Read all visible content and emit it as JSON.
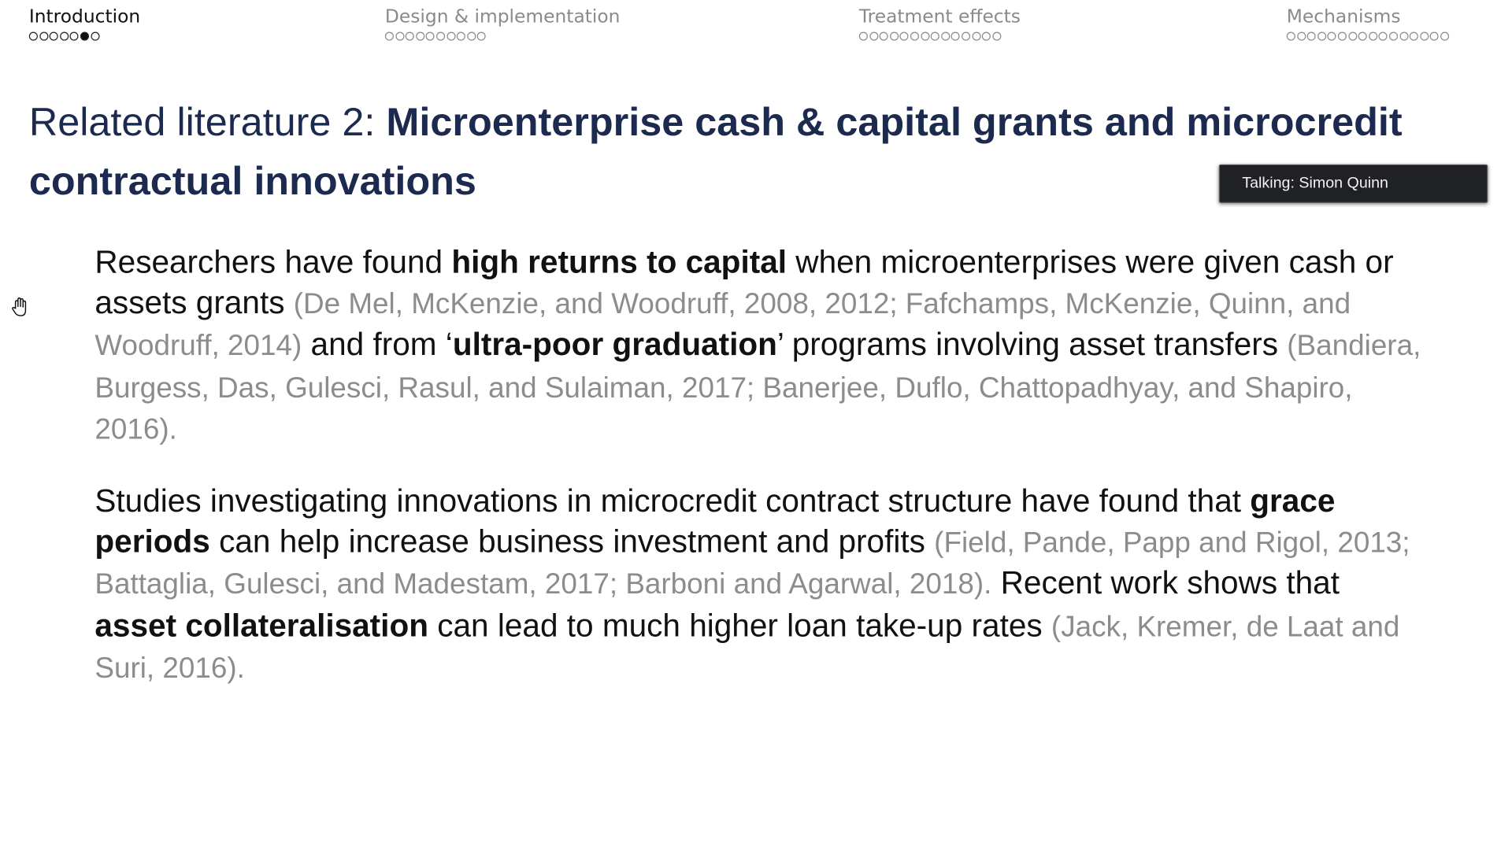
{
  "nav": {
    "sections": [
      {
        "title": "Introduction",
        "dot_count": 7,
        "filled_index": 5,
        "current": true
      },
      {
        "title": "Design & implementation",
        "dot_count": 10,
        "filled_index": -1,
        "current": false
      },
      {
        "title": "Treatment effects",
        "dot_count": 14,
        "filled_index": -1,
        "current": false
      },
      {
        "title": "Mechanisms",
        "dot_count": 16,
        "filled_index": -1,
        "current": false
      }
    ]
  },
  "slide": {
    "title_prefix": "Related literature 2: ",
    "title_bold": "Microenterprise cash & capital grants and microcredit contractual innovations",
    "paragraph_1": {
      "t1": "Researchers have found ",
      "b1": "high returns to capital",
      "t2": " when microenterprises were given cash or assets grants ",
      "c1": "(De Mel, McKenzie, and Woodruff, 2008, 2012; Fafchamps, McKenzie, Quinn, and Woodruff, 2014)",
      "t3": " and from ‘",
      "b2": "ultra-poor graduation",
      "t4": "’ programs involving asset transfers ",
      "c2": "(Bandiera, Burgess, Das, Gulesci, Rasul, and Sulaiman, 2017; Banerjee, Duflo, Chattopadhyay, and Shapiro, 2016)."
    },
    "paragraph_2": {
      "t1": "Studies investigating innovations in microcredit contract structure have found that ",
      "b1": "grace periods",
      "t2": " can help increase business investment and profits ",
      "c1": "(Field, Pande, Papp and Rigol, 2013; Battaglia, Gulesci, and Madestam, 2017; Barboni and Agarwal, 2018).",
      "t3": " Recent work shows that ",
      "b2": "asset collateralisation",
      "t4": " can lead to much higher loan take-up rates ",
      "c2": "(Jack, Kremer, de Laat and Suri, 2016)."
    }
  },
  "talking": {
    "label": "Talking: Simon Quinn"
  },
  "colors": {
    "title": "#1c2a4f",
    "citation": "#8c8c8c",
    "indicator_bg": "#1f2124"
  },
  "icons": {
    "cursor": "hand-grab-icon"
  }
}
